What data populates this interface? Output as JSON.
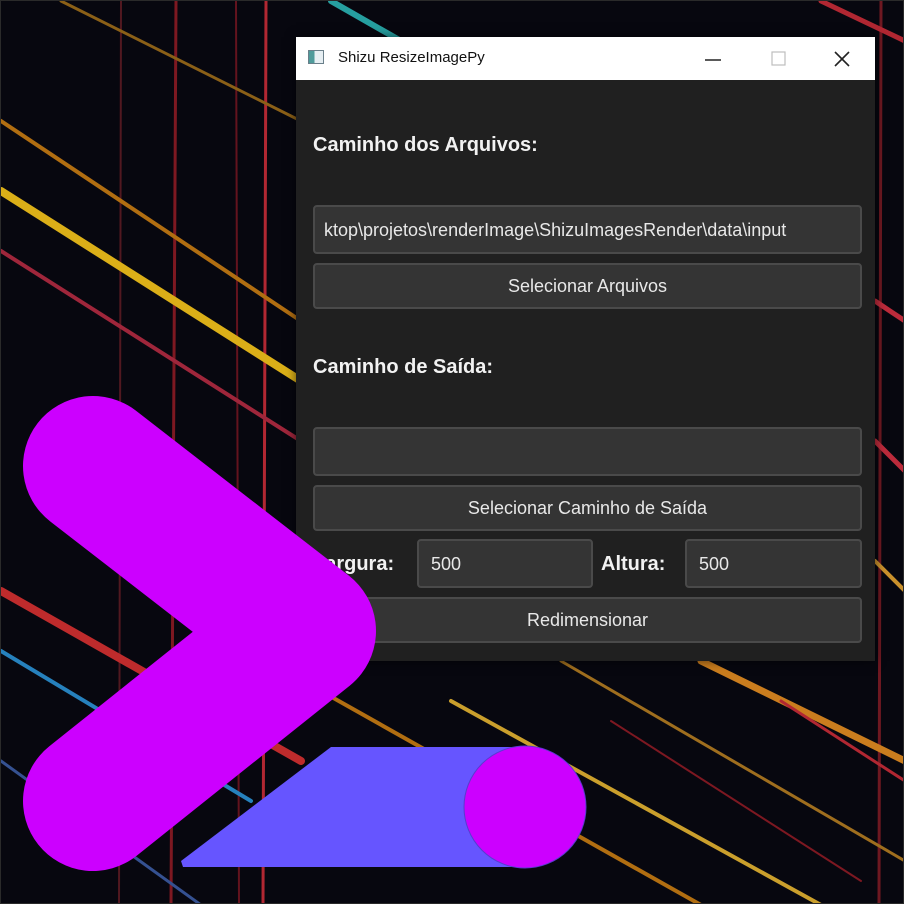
{
  "window": {
    "title": "Shizu ResizeImagePy",
    "controls": {
      "minimize_icon": "minimize-icon",
      "maximize_icon": "maximize-icon",
      "close_icon": "close-icon"
    }
  },
  "form": {
    "input_path": {
      "label": "Caminho dos Arquivos:",
      "value": "ktop\\projetos\\renderImage\\ShizuImagesRender\\data\\input",
      "button": "Selecionar Arquivos"
    },
    "output_path": {
      "label": "Caminho de Saída:",
      "value": "",
      "button": "Selecionar Caminho de Saída"
    },
    "size": {
      "width_label": "Largura:",
      "width_value": "500",
      "height_label": "Altura:",
      "height_value": "500"
    },
    "resize_button": "Redimensionar"
  },
  "colors": {
    "window_bg": "#202020",
    "field_bg": "#343434",
    "overlay_magenta": "#cc00ff",
    "overlay_blue": "#6655ff"
  },
  "overlay": {
    "chevron_icon": "chevron-prompt-icon",
    "cursor_icon": "underscore-cursor-icon"
  }
}
